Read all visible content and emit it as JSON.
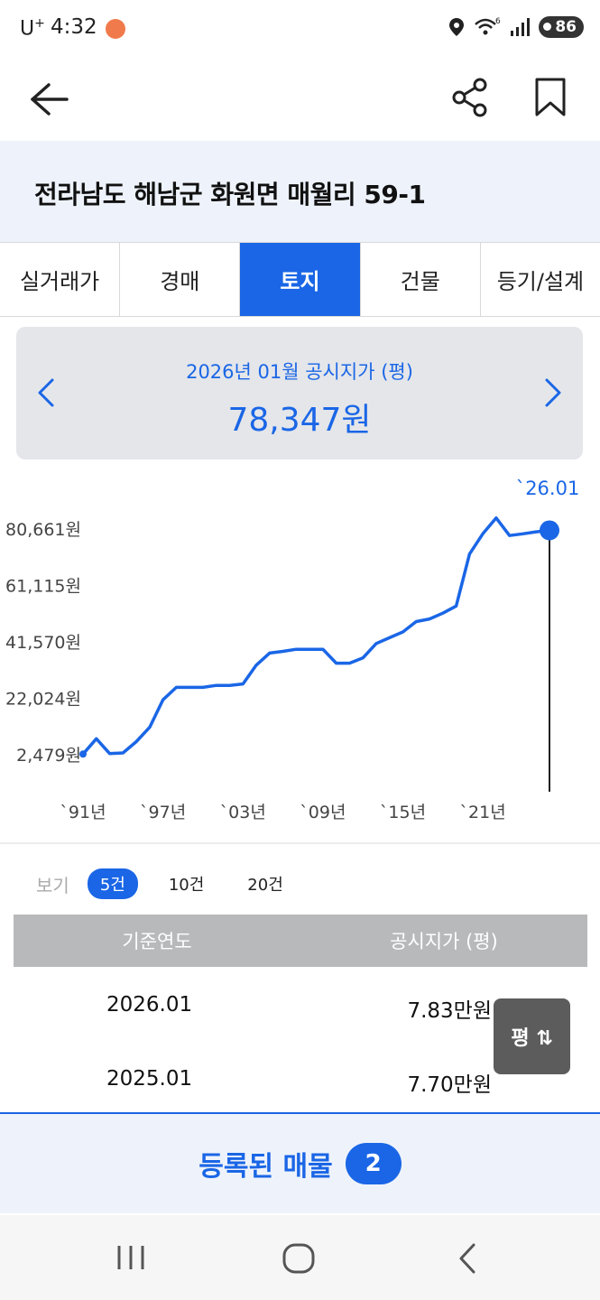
{
  "status_bar": {
    "carrier": "U",
    "carrier_sup": "+",
    "time": "4:32",
    "battery": "86",
    "wifi_badge": "6"
  },
  "header": {
    "back_icon": "back-arrow-icon",
    "share_icon": "share-icon",
    "bookmark_icon": "bookmark-icon"
  },
  "address": "전라남도 해남군 화원면 매월리 59-1",
  "tabs": [
    {
      "label": "실거래가",
      "active": false
    },
    {
      "label": "경매",
      "active": false
    },
    {
      "label": "토지",
      "active": true
    },
    {
      "label": "건물",
      "active": false
    },
    {
      "label": "등기/설계",
      "active": false
    }
  ],
  "price_card": {
    "label": "2026년 01월 공시지가 (평)",
    "value": "78,347원"
  },
  "chart_data": {
    "type": "line",
    "y_tick_labels": [
      "80,661원",
      "61,115원",
      "41,570원",
      "22,024원",
      "2,479원"
    ],
    "y_ticks": [
      80661,
      61115,
      41570,
      22024,
      2479
    ],
    "x_tick_labels": [
      "`91년",
      "`97년",
      "`03년",
      "`09년",
      "`15년",
      "`21년"
    ],
    "x_ticks": [
      1991,
      1997,
      2003,
      2009,
      2015,
      2021
    ],
    "highlight_label": "`26.01",
    "x": [
      1991,
      1992,
      1993,
      1994,
      1995,
      1996,
      1997,
      1998,
      1999,
      2000,
      2001,
      2002,
      2003,
      2004,
      2005,
      2006,
      2007,
      2008,
      2009,
      2010,
      2011,
      2012,
      2013,
      2014,
      2015,
      2016,
      2017,
      2018,
      2019,
      2020,
      2021,
      2022,
      2023,
      2024,
      2025,
      2026
    ],
    "values": [
      2700,
      8000,
      2900,
      3100,
      7000,
      12000,
      21500,
      25800,
      25800,
      25800,
      26500,
      26500,
      27000,
      33500,
      37700,
      38300,
      39000,
      39000,
      39000,
      34200,
      34200,
      36000,
      41000,
      43000,
      45000,
      48600,
      49500,
      51500,
      54000,
      72000,
      79000,
      84500,
      78400,
      79000,
      79700,
      80200
    ]
  },
  "view_options": {
    "label": "보기",
    "options": [
      "5건",
      "10건",
      "20건"
    ],
    "active": "5건"
  },
  "table": {
    "headers": [
      "기준연도",
      "공시지가 (평)"
    ],
    "rows": [
      {
        "year": "2026.01",
        "price": "7.83만원"
      },
      {
        "year": "2025.01",
        "price": "7.70만원"
      }
    ]
  },
  "float_button": {
    "label": "평 ⇅"
  },
  "listing": {
    "label": "등록된 매물",
    "count": "2"
  },
  "nav_bar": {
    "recent_icon": "recent-apps-icon",
    "home_icon": "home-icon",
    "back_icon": "nav-back-icon"
  },
  "colors": {
    "accent": "#1a66e6",
    "header_band": "#eef3fb"
  }
}
